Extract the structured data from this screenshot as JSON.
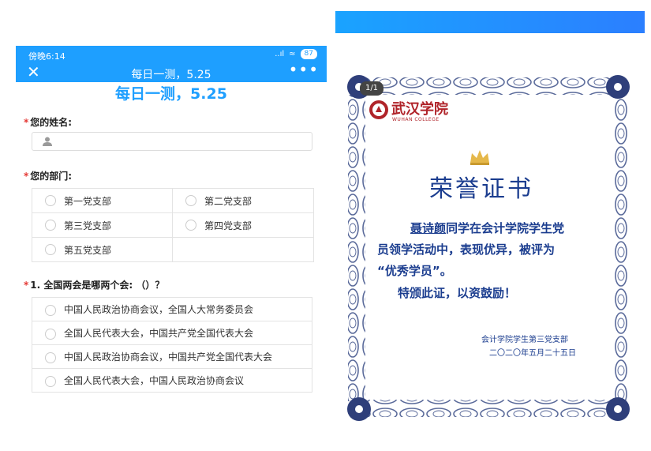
{
  "status_bar": {
    "time": "傍晚6:14",
    "signal": "..ıl",
    "wifi": "≈",
    "battery": "87"
  },
  "nav": {
    "title": "每日一测，5.25",
    "close_glyph": "✕",
    "more_glyph": "•••"
  },
  "survey": {
    "title": "每日一测，5.25",
    "q_name": {
      "required": "*",
      "label": "您的姓名:"
    },
    "q_dept": {
      "required": "*",
      "label": "您的部门:",
      "options": [
        "第一党支部",
        "第二党支部",
        "第三党支部",
        "第四党支部",
        "第五党支部"
      ]
    },
    "q1": {
      "required": "*",
      "label": "1. 全国两会是哪两个会: （）？",
      "options": [
        "中国人民政治协商会议，全国人大常务委员会",
        "全国人民代表大会，中国共产党全国代表大会",
        "中国人民政治协商会议，中国共产党全国代表大会",
        "全国人民代表大会，中国人民政治协商会议"
      ]
    }
  },
  "certificate": {
    "page_indicator": "1/1",
    "college_cn": "武汉学院",
    "college_en": "WUHAN COLLEGE",
    "title": "荣誉证书",
    "recipient": "聂诗颜",
    "body_1": "同学在会计学院学生党",
    "body_2": "员领学活动中，表现优异，被评为",
    "body_3": "“优秀学员”。",
    "closing": "特颁此证，以资鼓励！",
    "issuer": "会计学院学生第三党支部",
    "date": "二〇二〇年五月二十五日"
  },
  "colors": {
    "accent_blue": "#1e9fff",
    "cert_blue": "#1b3d8f",
    "cert_red": "#b0242a",
    "required_red": "#e53935"
  }
}
